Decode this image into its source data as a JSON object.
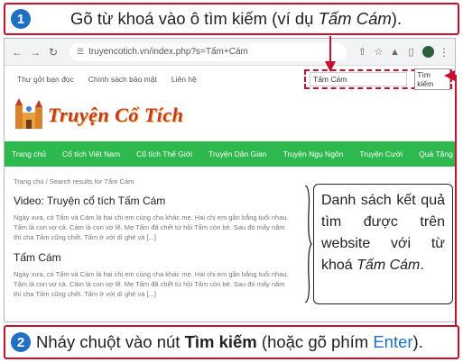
{
  "step1": {
    "number": "1",
    "text_before": "Gõ từ khoá vào ô tìm kiếm (ví dụ ",
    "text_italic": "Tấm Cám",
    "text_after": ")."
  },
  "browser": {
    "url": "truyencotich.vn/index.php?s=Tấm+Cám",
    "icons": [
      "back-icon",
      "forward-icon",
      "reload-icon",
      "share-icon",
      "star-icon",
      "extension-icon",
      "sidebar-icon",
      "profile-avatar",
      "menu-icon"
    ]
  },
  "topbar": {
    "links": [
      "Thư gởi bạn đọc",
      "Chính sách bảo mật",
      "Liên hệ"
    ],
    "search_value": "Tấm Cám",
    "search_button": "Tìm kiếm"
  },
  "logo": {
    "text": "Truyện Cổ Tích"
  },
  "nav": {
    "items": [
      "Trang chủ",
      "Cổ tích Việt Nam",
      "Cổ tích Thế Giới",
      "Truyện Dân Gian",
      "Truyện Ngụ Ngôn",
      "Truyện Cười",
      "Quà Tặng Cuộc Sống"
    ]
  },
  "breadcrumb": "Trang chủ / Search results for Tấm Cám",
  "results": [
    {
      "title": "Video: Truyện cổ tích Tấm Cám",
      "snippet": "Ngày xưa, có Tấm và Cám là hai chị em cùng cha khác mẹ. Hai chị em gần bằng tuổi nhau. Tấm là con vợ cả. Cám là con vợ lẽ. Mẹ Tấm đã chết từ hồi Tấm còn bé. Sau đó mấy năm thì cha Tấm cũng chết. Tấm ở với dì ghẻ và [...]"
    },
    {
      "title": "Tấm Cám",
      "snippet": "Ngày xưa, có Tấm và Cám là hai chị em cùng cha khác mẹ. Hai chị em gần bằng tuổi nhau. Tấm là con vợ cả. Cám là con vợ lẽ. Mẹ Tấm đã chết từ hồi Tấm còn bé. Sau đó mấy năm thì cha Tấm cũng chết. Tấm ở với dì ghẻ và [...]"
    }
  ],
  "annotation": {
    "text_before": "Danh sách kết quả tìm được trên website với từ khoá ",
    "text_italic": "Tấm Cám",
    "text_after": "."
  },
  "step2": {
    "number": "2",
    "text_before": "Nháy chuột vào nút ",
    "text_bold": "Tìm kiếm",
    "text_middle": " (hoặc gõ phím ",
    "text_key": "Enter",
    "text_after": ")."
  },
  "colors": {
    "callout_border": "#c8102e",
    "badge": "#1f6fc5",
    "nav_green": "#2db94d",
    "logo_red": "#c0392b"
  }
}
